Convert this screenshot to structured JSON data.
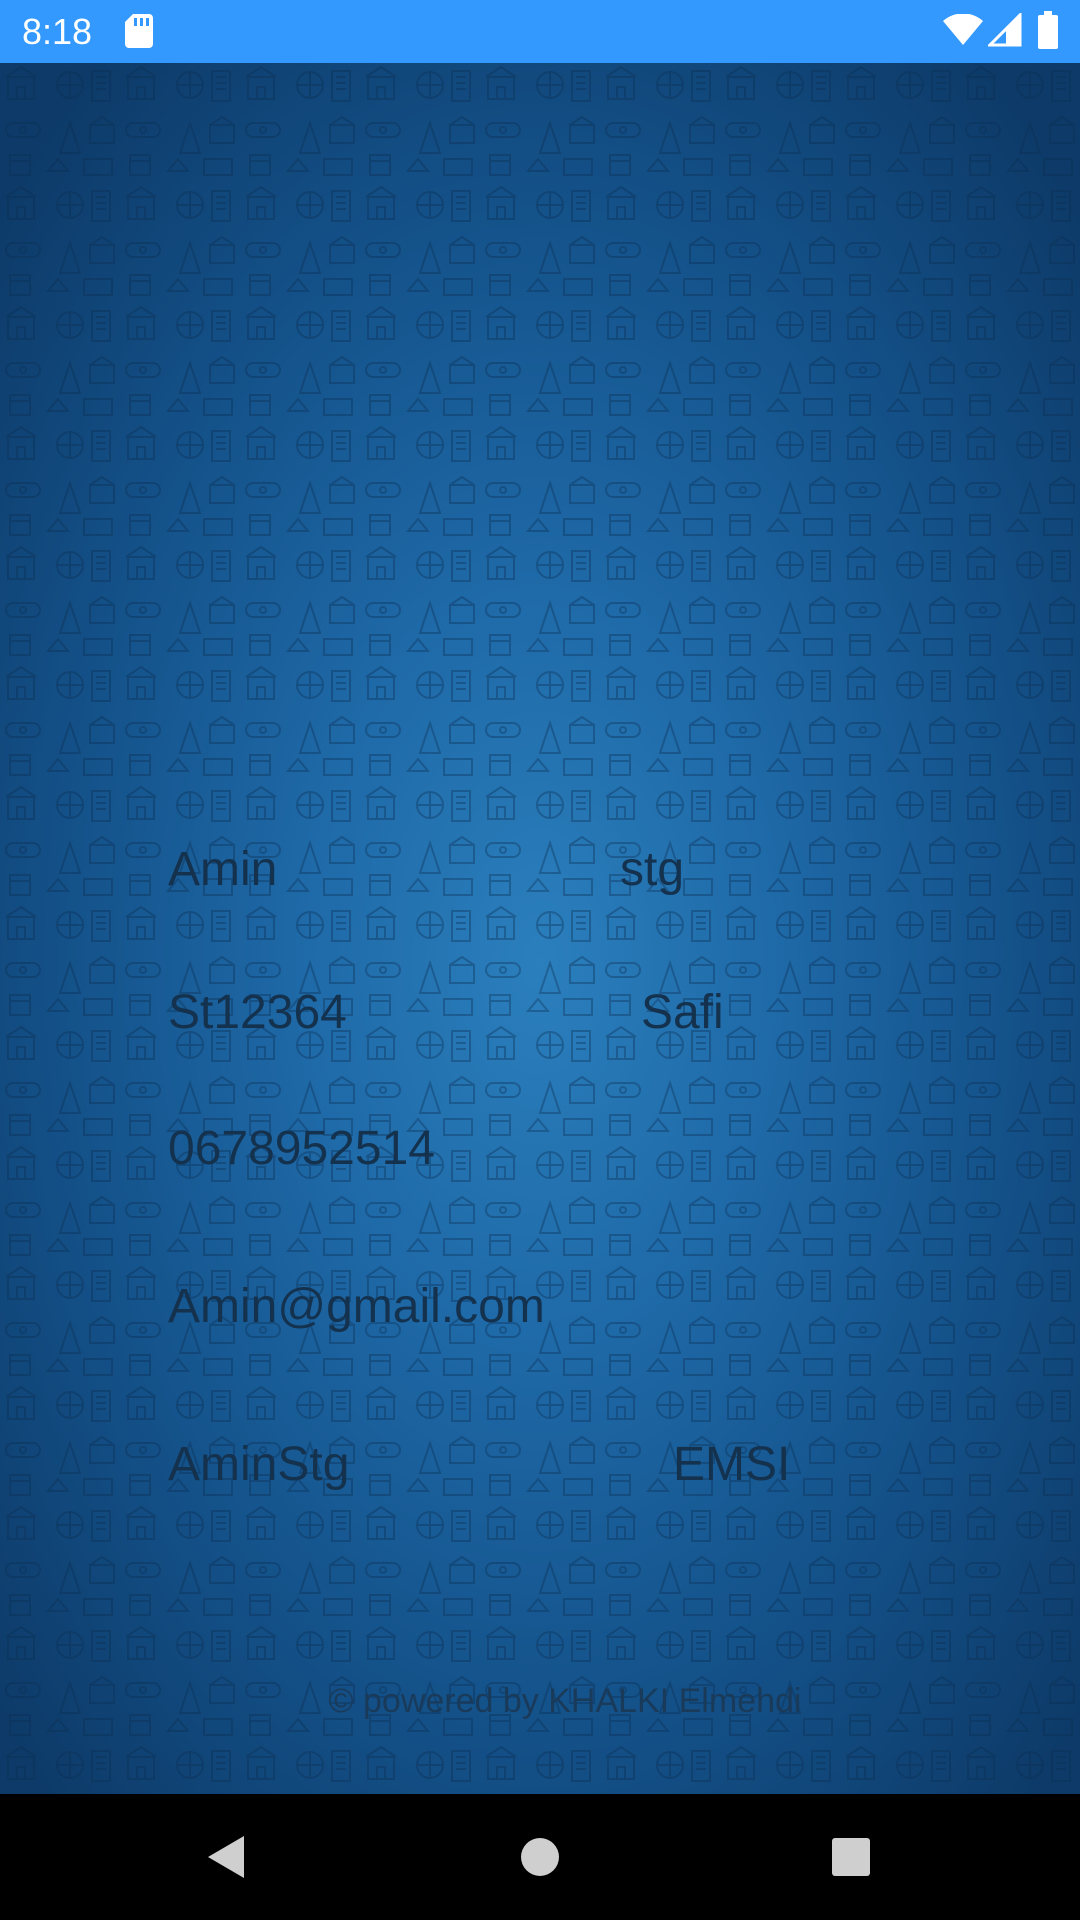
{
  "status_bar": {
    "time": "8:18",
    "background": "#3399ff",
    "icons": [
      "sd-card-icon",
      "wifi-icon",
      "cellular-signal-icon",
      "battery-icon"
    ]
  },
  "profile": {
    "first_name": "Amin",
    "last_name": "stg",
    "student_id": "St12364",
    "city": "Safi",
    "phone": "0678952514",
    "email": "Amin@gmail.com",
    "username": "AminStg",
    "school": "EMSI"
  },
  "footer": {
    "text": "© powered by KHALKI Elmehdi"
  },
  "nav_bar": {
    "buttons": [
      "back-icon",
      "home-icon",
      "recents-icon"
    ]
  }
}
